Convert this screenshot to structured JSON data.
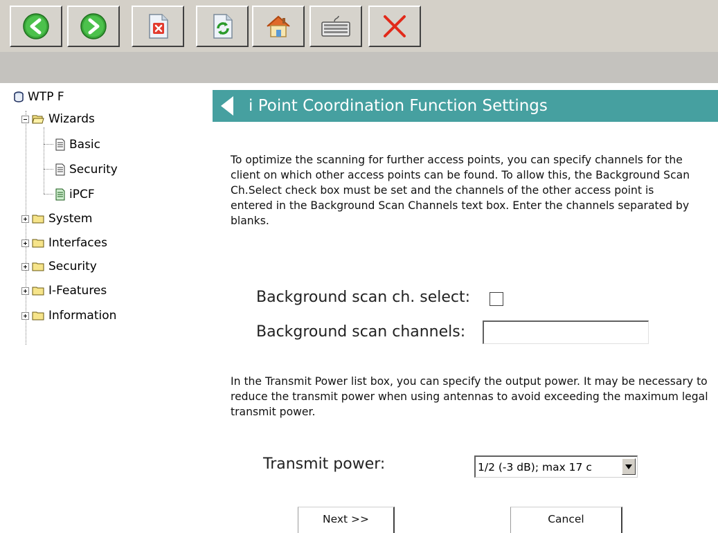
{
  "toolbar": {
    "buttons": [
      {
        "name": "back",
        "icon": "arrow-left-icon"
      },
      {
        "name": "forward",
        "icon": "arrow-right-icon"
      },
      {
        "name": "stop",
        "icon": "stop-page-icon"
      },
      {
        "name": "refresh",
        "icon": "refresh-page-icon"
      },
      {
        "name": "home",
        "icon": "home-icon"
      },
      {
        "name": "keyboard",
        "icon": "keyboard-icon"
      },
      {
        "name": "close",
        "icon": "close-x-icon"
      }
    ]
  },
  "tree": {
    "root": "WTP F",
    "wizards": "Wizards",
    "basic": "Basic",
    "security_sub": "Security",
    "ipcf": "iPCF",
    "system": "System",
    "interfaces": "Interfaces",
    "security": "Security",
    "ifeatures": "I-Features",
    "information": "Information"
  },
  "main": {
    "title": "i Point Coordination Function Settings",
    "intro": "To optimize the scanning for further access points, you can specify channels for the client on which other access points can be found. To allow this, the Background Scan Ch.Select check box must be set and the channels of the other access point is entered in the Background Scan Channels text box. Enter the channels separated by blanks.",
    "bg_select_label": "Background scan ch. select:",
    "bg_select_checked": false,
    "bg_channels_label": "Background scan channels:",
    "bg_channels_value": "",
    "tx_intro": "In the Transmit Power list box, you can specify the output power. It may be necessary to reduce the transmit power when using antennas to avoid exceeding the maximum legal transmit power.",
    "tx_label": "Transmit power:",
    "tx_value": "1/2 (-3 dB); max 17 c",
    "next_label": "Next >>",
    "cancel_label": "Cancel"
  },
  "colors": {
    "header_band": "#46a0a0",
    "toolbar_bg": "#d4d0c8"
  }
}
